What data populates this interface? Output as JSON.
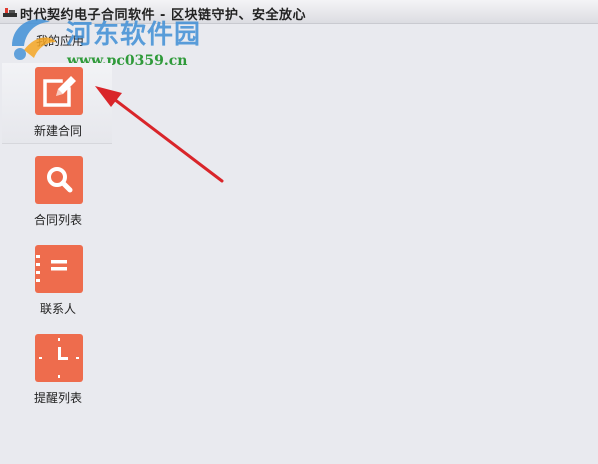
{
  "window": {
    "title": "时代契约电子合同软件 - 区块链守护、安全放心"
  },
  "menu": {
    "label": "我的应用"
  },
  "watermark": {
    "text": "河东软件园",
    "url": "www.pc0359.cn"
  },
  "nav": {
    "items": [
      {
        "label": "新建合同",
        "icon": "edit-icon",
        "active": true
      },
      {
        "label": "合同列表",
        "icon": "search-icon",
        "active": false
      },
      {
        "label": "联系人",
        "icon": "notebook-icon",
        "active": false
      },
      {
        "label": "提醒列表",
        "icon": "clock-icon",
        "active": false
      }
    ]
  },
  "colors": {
    "tile": "#ee6c4d",
    "background": "#e9eaef",
    "arrow": "#d9252a",
    "watermark_blue": "#3f8fd6",
    "watermark_green": "#2f9a3a"
  }
}
